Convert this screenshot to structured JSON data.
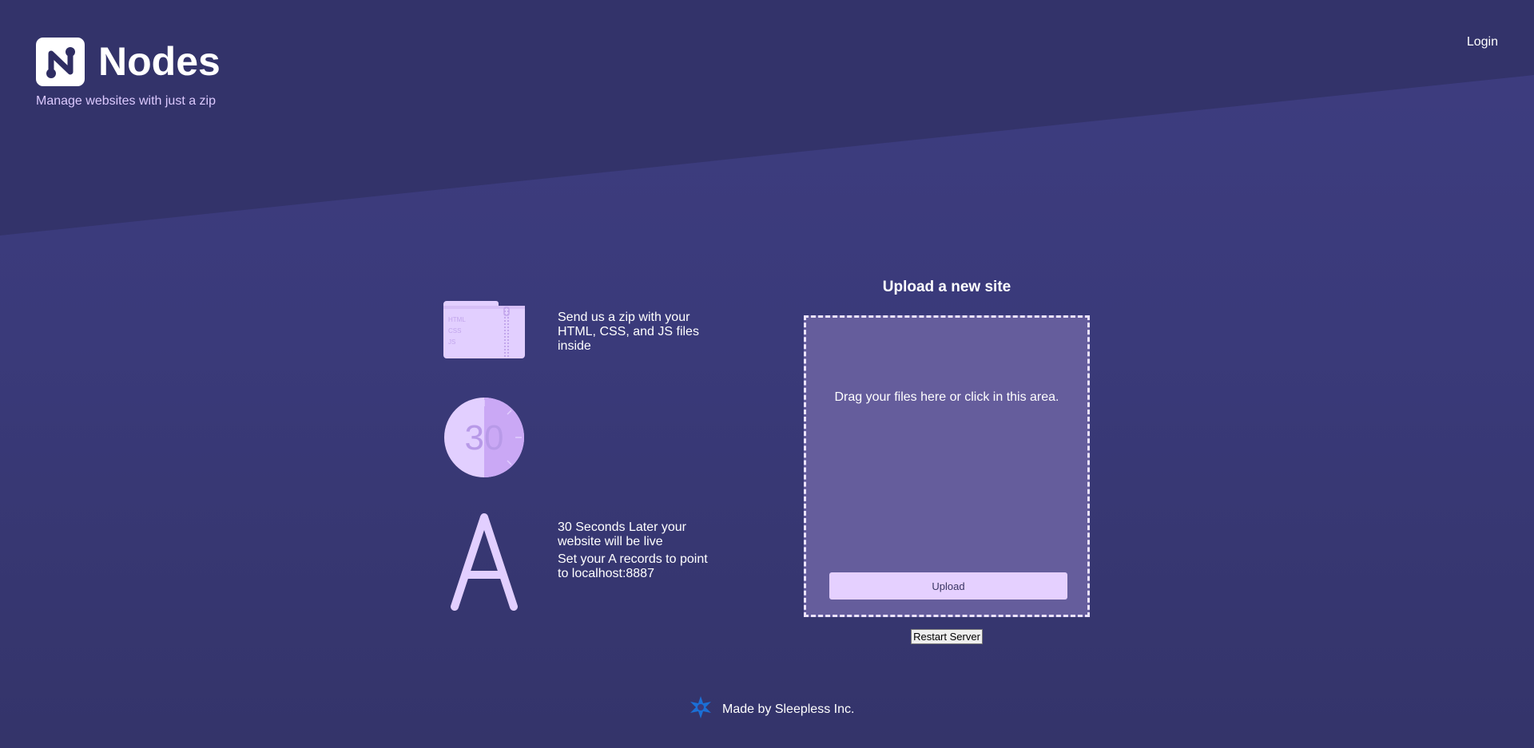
{
  "brand": {
    "name": "Nodes",
    "tagline": "Manage websites with just a zip",
    "logo_icon": "nodes-n-logo-icon"
  },
  "nav": {
    "login_label": "Login"
  },
  "steps": [
    {
      "icon": "zip-folder-icon",
      "icon_labels": [
        "HTML",
        "CSS",
        "JS"
      ],
      "text": "Send us a zip with your HTML, CSS, and JS files inside"
    },
    {
      "icon": "timer-30-icon",
      "icon_label": "30",
      "text": "30 Seconds Later your website will be live"
    },
    {
      "icon": "letter-a-icon",
      "text": "Set your A records to point to localhost:8887"
    }
  ],
  "upload": {
    "title": "Upload a new site",
    "dropzone_text": "Drag your files here or click in this area.",
    "upload_label": "Upload",
    "restart_label": "Restart Server"
  },
  "footer": {
    "text": "Made by Sleepless Inc.",
    "logo_icon": "sleepless-star-icon"
  },
  "colors": {
    "background": "#3b3a7a",
    "top_band": "#33336a",
    "accent": "#e5d0ff",
    "icon_fill": "#e2cfff",
    "dropzone": "#655d9c",
    "tagline": "#dcc9ff"
  }
}
